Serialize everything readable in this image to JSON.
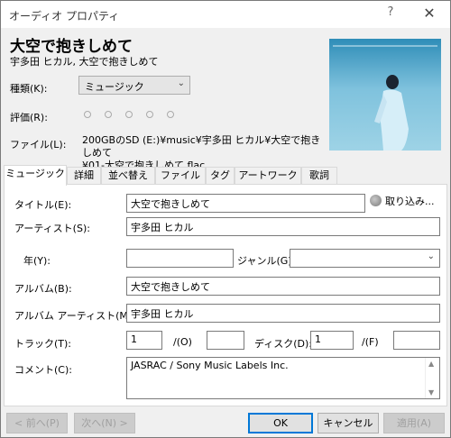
{
  "window": {
    "title": "オーディオ プロパティ",
    "help": "?",
    "close": "✕"
  },
  "header": {
    "title": "大空で抱きしめて",
    "subtitle": "宇多田 ヒカル, 大空で抱きしめて"
  },
  "kind": {
    "label": "種類(K):",
    "value": "ミュージック"
  },
  "rating": {
    "label": "評価(R):",
    "stars": 5,
    "value": 0
  },
  "file": {
    "label": "ファイル(L):",
    "path_line1": "200GBのSD (E:)¥music¥宇多田 ヒカル¥大空で抱きしめて",
    "path_line2": "¥01-大空で抱きしめて.flac"
  },
  "tabs": [
    {
      "label": "ミュージック"
    },
    {
      "label": "詳細"
    },
    {
      "label": "並べ替え"
    },
    {
      "label": "ファイル"
    },
    {
      "label": "タグ"
    },
    {
      "label": "アートワーク"
    },
    {
      "label": "歌詞"
    }
  ],
  "form": {
    "title_label": "タイトル(E):",
    "title_value": "大空で抱きしめて",
    "fetch_label": "取り込み...",
    "artist_label": "アーティスト(S):",
    "artist_value": "宇多田 ヒカル",
    "year_label": "年(Y):",
    "year_value": "",
    "genre_label": "ジャンル(G)",
    "genre_value": "",
    "album_label": "アルバム(B):",
    "album_value": "大空で抱きしめて",
    "album_artist_label": "アルバム アーティスト(M):",
    "album_artist_value": "宇多田 ヒカル",
    "track_label": "トラック(T):",
    "track_value": "1",
    "track_of_label": "/(O)",
    "track_total": "",
    "disc_label": "ディスク(D):",
    "disc_value": "1",
    "disc_of_label": "/(F)",
    "disc_total": "",
    "comment_label": "コメント(C):",
    "comment_value": "JASRAC / Sony Music Labels Inc."
  },
  "buttons": {
    "prev": "< 前へ(P)",
    "next": "次へ(N) >",
    "ok": "OK",
    "cancel": "キャンセル",
    "apply": "適用(A)"
  },
  "colors": {
    "accent": "#0078d7",
    "window_bg": "#f0f0f0"
  }
}
